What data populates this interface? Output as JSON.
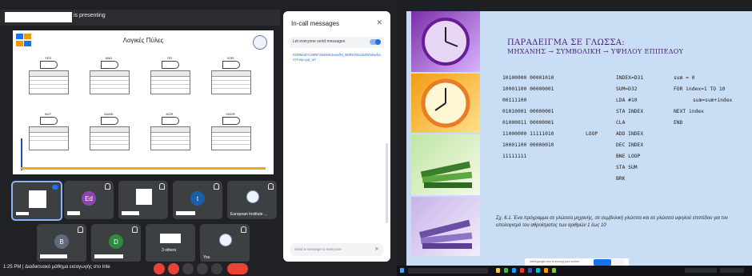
{
  "meeting": {
    "presenting_suffix": "is presenting",
    "slide_title": "Λογικές Πύλες",
    "gates": [
      {
        "label": "YES",
        "input_header": "INPUT",
        "output_header": "OUTPUT"
      },
      {
        "label": "AND",
        "input_header": "INPUT",
        "output_header": "OUTPUT"
      },
      {
        "label": "OR",
        "input_header": "INPUT",
        "output_header": "OUTPUT"
      },
      {
        "label": "XOR",
        "input_header": "INPUT",
        "output_header": "OUTPUT"
      },
      {
        "label": "NOT",
        "input_header": "INPUT",
        "output_header": "OUTPUT"
      },
      {
        "label": "NAND",
        "input_header": "INPUT",
        "output_header": "OUTPUT"
      },
      {
        "label": "NOR",
        "input_header": "INPUT",
        "output_header": "OUTPUT"
      },
      {
        "label": "XNOR",
        "input_header": "INPUT",
        "output_header": "OUTPUT"
      }
    ],
    "participants": [
      {
        "name": ""
      },
      {
        "initial": "Ed",
        "name": ""
      },
      {
        "name": ""
      },
      {
        "initial": "t",
        "name": ""
      },
      {
        "name": "European Institute ..."
      },
      {
        "initial": "B",
        "name": ""
      },
      {
        "initial": "D",
        "name": ""
      },
      {
        "name": "3 others"
      },
      {
        "name": "You"
      }
    ],
    "bottom_time": "1:25 PM",
    "bottom_meeting": "Διαδικτυακό μάθημα εισαγωγής στο Inte"
  },
  "chat": {
    "title": "In-call messages",
    "close_glyph": "✕",
    "allow_label": "Let everyone send messages",
    "link_text": "KN9M427zJ8RF25s9vEJseafXi_B8Rtzhtsvi4Z0/viewform?usp=pp_url",
    "input_placeholder": "Send a message to everyone",
    "send_glyph": "➤"
  },
  "slide_right": {
    "title": "ΠΑΡΑΔΕΙΓΜΑ  ΣΕ ΓΛΩΣΣΑ:",
    "subtitle": "ΜΗΧΑΝΗΣ  → ΣΥΜΒΟΛΙΚΗ  → ΥΨΗΛΟΥ ΕΠΙΠΕΔΟΥ",
    "machine_code": [
      "10100000 00001010",
      "10001100 00000001",
      "00111100",
      "01010001 00000001",
      "01000011 00000001",
      "11000000 11111010",
      "10001100 00000010",
      "11111111"
    ],
    "labels": [
      "",
      "",
      "",
      "",
      "",
      "LOOP",
      "",
      ""
    ],
    "assembly": [
      "INDEX=D31",
      "SUM=D32",
      "LDA #10",
      "STA INDEX",
      "CLA",
      "ADD INDEX",
      "DEC INDEX",
      "BNE LOOP",
      "STA SUM",
      "BRK"
    ],
    "high_level": [
      "sum = 0",
      "FOR index=1 TO 10",
      "sum=sum+index",
      "NEXT index",
      "END"
    ],
    "caption": "Σχ. 6.1. Ένα πρόγραμμα σε γλώσσα μηχανής, σε συμβολική γλώσσα και σε γλώσσα υψηλού επιπέδου για τον υπολογισμό του αθροίσματος των αριθμών 1 έως 10",
    "share_text": "meet.google.com is sharing your screen"
  }
}
